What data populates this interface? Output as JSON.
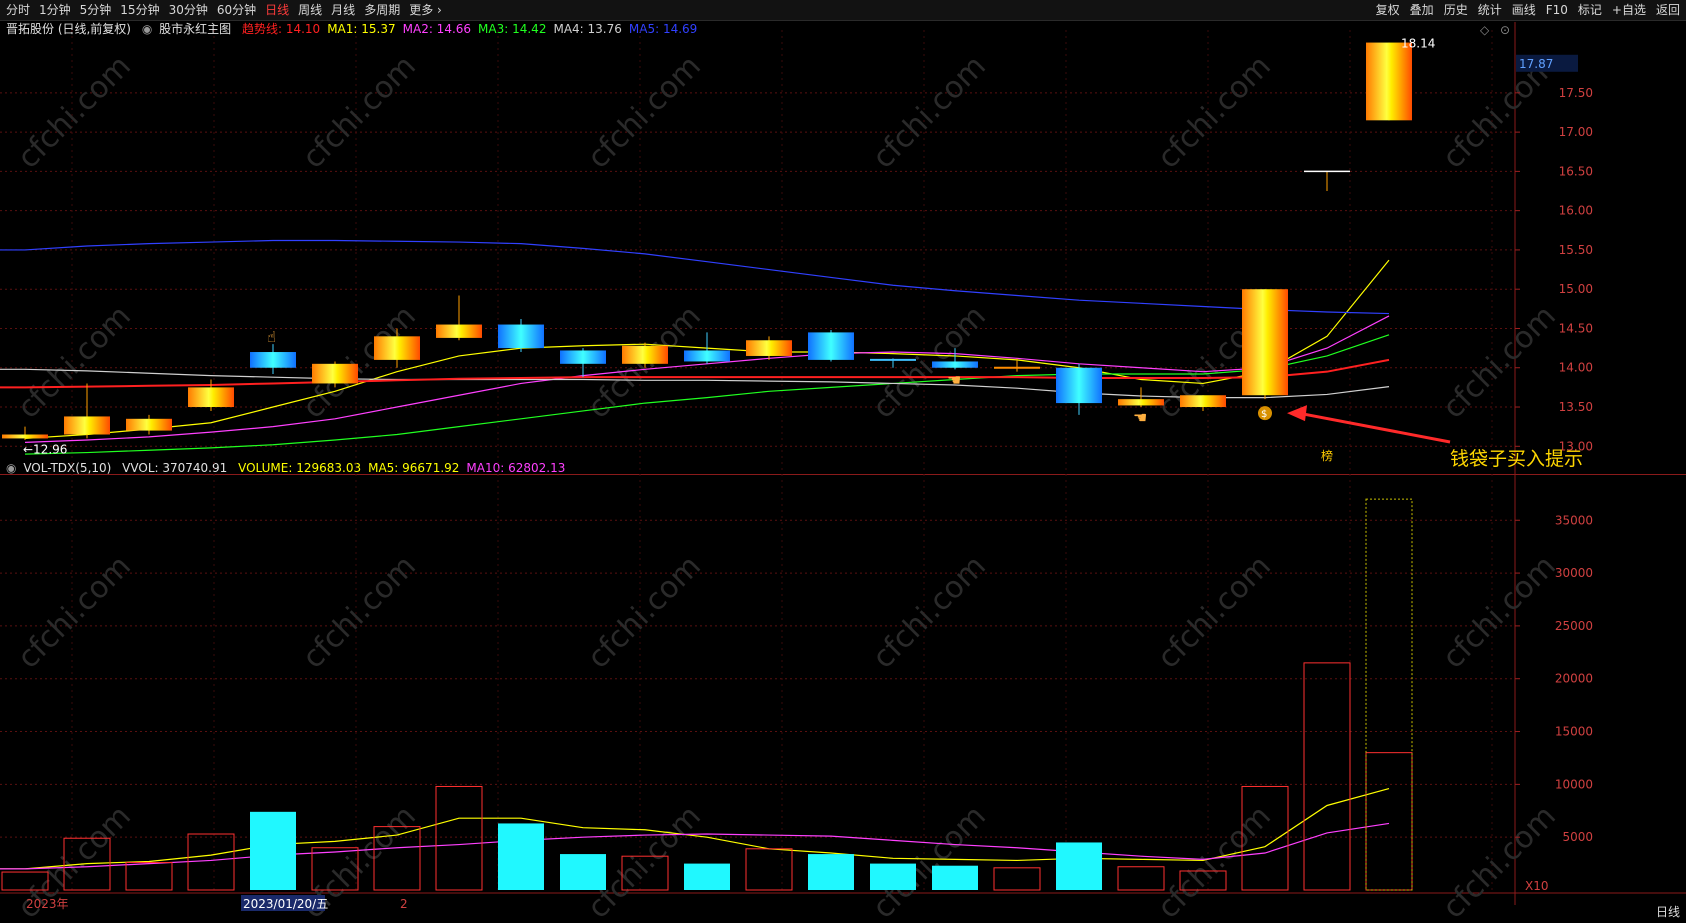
{
  "toolbar": {
    "left_tabs": [
      "分时",
      "1分钟",
      "5分钟",
      "15分钟",
      "30分钟",
      "60分钟",
      "日线",
      "周线",
      "月线",
      "多周期",
      "更多 ›"
    ],
    "active_tab": "日线",
    "right_tabs": [
      "复权",
      "叠加",
      "历史",
      "统计",
      "画线",
      "F10",
      "标记",
      "+自选",
      "返回"
    ]
  },
  "main_legend": {
    "stock": "晋拓股份 (日线,前复权)",
    "indicator": "股市永红主图",
    "items": [
      {
        "label": "趋势线: 14.10",
        "color": "#ff2020"
      },
      {
        "label": "MA1: 15.37",
        "color": "#ffff00"
      },
      {
        "label": "MA2: 14.66",
        "color": "#ff40ff"
      },
      {
        "label": "MA3: 14.42",
        "color": "#20ff20"
      },
      {
        "label": "MA4: 13.76",
        "color": "#d0d0d0"
      },
      {
        "label": "MA5: 14.69",
        "color": "#3040ff"
      }
    ]
  },
  "vol_legend": {
    "name": "VOL-TDX(5,10)",
    "vvol": "VVOL: 370740.91",
    "items": [
      {
        "label": "VOLUME: 129683.03",
        "color": "#ffff00"
      },
      {
        "label": "MA5: 96671.92",
        "color": "#ffff00"
      },
      {
        "label": "MA10: 62802.13",
        "color": "#ff40ff"
      }
    ]
  },
  "price_axis": {
    "ticks": [
      "17.50",
      "17.00",
      "16.50",
      "16.00",
      "15.50",
      "15.00",
      "14.50",
      "14.00",
      "13.50",
      "13.00"
    ],
    "current_price": "17.87"
  },
  "vol_axis": {
    "ticks": [
      "35000",
      "30000",
      "25000",
      "20000",
      "15000",
      "10000",
      "5000"
    ],
    "unit": "X10"
  },
  "annotations": {
    "high": "18.14",
    "low": "←12.96",
    "callout": "钱袋子买入提示",
    "badge": "榜"
  },
  "date_axis": {
    "labels": [
      "2023年",
      "2023/01/20/五",
      "2"
    ]
  },
  "period_label": "日线",
  "chart_data": {
    "type": "candlestick",
    "price_ylim": [
      12.8,
      18.3
    ],
    "volume_ylim": [
      0,
      39000
    ],
    "candles": [
      {
        "o": 13.1,
        "c": 13.15,
        "h": 13.25,
        "l": 13.08,
        "v": 1700,
        "up": true
      },
      {
        "o": 13.15,
        "c": 13.38,
        "h": 13.8,
        "l": 13.1,
        "v": 4900,
        "up": true
      },
      {
        "o": 13.2,
        "c": 13.35,
        "h": 13.4,
        "l": 13.15,
        "v": 2600,
        "up": true
      },
      {
        "o": 13.5,
        "c": 13.75,
        "h": 13.85,
        "l": 13.45,
        "v": 5300,
        "up": true
      },
      {
        "o": 14.2,
        "c": 14.0,
        "h": 14.3,
        "l": 13.92,
        "v": 7400,
        "up": false
      },
      {
        "o": 13.8,
        "c": 14.05,
        "h": 14.08,
        "l": 13.75,
        "v": 4000,
        "up": true
      },
      {
        "o": 14.1,
        "c": 14.4,
        "h": 14.5,
        "l": 14.0,
        "v": 6000,
        "up": true
      },
      {
        "o": 14.38,
        "c": 14.55,
        "h": 14.92,
        "l": 14.35,
        "v": 9800,
        "up": true
      },
      {
        "o": 14.55,
        "c": 14.25,
        "h": 14.62,
        "l": 14.2,
        "v": 6300,
        "up": false
      },
      {
        "o": 14.22,
        "c": 14.05,
        "h": 14.25,
        "l": 13.88,
        "v": 3400,
        "up": false
      },
      {
        "o": 14.05,
        "c": 14.28,
        "h": 14.32,
        "l": 14.0,
        "v": 3200,
        "up": true
      },
      {
        "o": 14.22,
        "c": 14.08,
        "h": 14.45,
        "l": 14.05,
        "v": 2500,
        "up": false
      },
      {
        "o": 14.15,
        "c": 14.35,
        "h": 14.4,
        "l": 14.1,
        "v": 3900,
        "up": true
      },
      {
        "o": 14.45,
        "c": 14.1,
        "h": 14.48,
        "l": 14.08,
        "v": 3400,
        "up": false
      },
      {
        "o": 14.1,
        "c": 14.08,
        "h": 14.12,
        "l": 14.0,
        "v": 2500,
        "up": false
      },
      {
        "o": 14.08,
        "c": 14.0,
        "h": 14.25,
        "l": 13.98,
        "v": 2300,
        "up": false
      },
      {
        "o": 14.0,
        "c": 14.02,
        "h": 14.12,
        "l": 13.95,
        "v": 2100,
        "up": true
      },
      {
        "o": 14.0,
        "c": 13.55,
        "h": 14.05,
        "l": 13.4,
        "v": 4500,
        "up": false
      },
      {
        "o": 13.52,
        "c": 13.6,
        "h": 13.75,
        "l": 13.5,
        "v": 2200,
        "up": true
      },
      {
        "o": 13.5,
        "c": 13.65,
        "h": 13.65,
        "l": 13.45,
        "v": 1800,
        "up": true
      },
      {
        "o": 13.65,
        "c": 15.0,
        "h": 15.0,
        "l": 13.6,
        "v": 9800,
        "up": true
      },
      {
        "o": 16.5,
        "c": 16.5,
        "h": 16.5,
        "l": 16.25,
        "v": 21500,
        "up": true
      },
      {
        "o": 17.15,
        "c": 18.14,
        "h": 18.14,
        "l": 17.15,
        "v": 13000,
        "vvol": 37000,
        "up": true
      }
    ],
    "series": [
      {
        "name": "MA1",
        "color": "#ffff00",
        "values": [
          13.1,
          13.15,
          13.22,
          13.3,
          13.5,
          13.7,
          13.95,
          14.15,
          14.25,
          14.28,
          14.3,
          14.25,
          14.2,
          14.2,
          14.18,
          14.15,
          14.1,
          14.0,
          13.85,
          13.8,
          13.95,
          14.4,
          15.37
        ]
      },
      {
        "name": "MA2",
        "color": "#ff40ff",
        "values": [
          13.05,
          13.08,
          13.12,
          13.18,
          13.25,
          13.35,
          13.5,
          13.65,
          13.8,
          13.9,
          13.98,
          14.05,
          14.12,
          14.18,
          14.2,
          14.18,
          14.12,
          14.05,
          14.0,
          13.95,
          14.0,
          14.25,
          14.66
        ]
      },
      {
        "name": "MA3",
        "color": "#20ff20",
        "values": [
          12.9,
          12.92,
          12.95,
          12.98,
          13.02,
          13.08,
          13.15,
          13.25,
          13.35,
          13.45,
          13.55,
          13.62,
          13.7,
          13.75,
          13.8,
          13.85,
          13.9,
          13.92,
          13.92,
          13.92,
          13.98,
          14.15,
          14.42
        ]
      },
      {
        "name": "MA4",
        "color": "#d0d0d0",
        "values": [
          13.98,
          13.96,
          13.93,
          13.9,
          13.88,
          13.86,
          13.85,
          13.85,
          13.85,
          13.85,
          13.84,
          13.84,
          13.83,
          13.82,
          13.8,
          13.78,
          13.74,
          13.68,
          13.64,
          13.62,
          13.62,
          13.66,
          13.76
        ]
      },
      {
        "name": "MA5",
        "color": "#3040ff",
        "values": [
          15.5,
          15.55,
          15.58,
          15.6,
          15.62,
          15.62,
          15.61,
          15.6,
          15.58,
          15.52,
          15.45,
          15.35,
          15.25,
          15.15,
          15.05,
          14.98,
          14.92,
          14.86,
          14.82,
          14.78,
          14.74,
          14.71,
          14.69
        ]
      },
      {
        "name": "趋势线",
        "color": "#ff2020",
        "values": [
          13.75,
          13.76,
          13.77,
          13.78,
          13.8,
          13.82,
          13.84,
          13.86,
          13.87,
          13.88,
          13.88,
          13.88,
          13.88,
          13.88,
          13.88,
          13.88,
          13.88,
          13.87,
          13.87,
          13.87,
          13.88,
          13.95,
          14.1
        ]
      }
    ],
    "vol_series": [
      {
        "name": "MA5",
        "color": "#ffff00",
        "values": [
          2000,
          2500,
          2700,
          3300,
          4300,
          4600,
          5200,
          6800,
          6800,
          5900,
          5700,
          5000,
          3900,
          3500,
          3000,
          2900,
          2800,
          3000,
          2900,
          2800,
          4100,
          8000,
          9600
        ]
      },
      {
        "name": "MA10",
        "color": "#ff40ff",
        "values": [
          2000,
          2200,
          2500,
          2800,
          3300,
          3600,
          4000,
          4300,
          4700,
          5000,
          5200,
          5300,
          5200,
          5100,
          4700,
          4300,
          4000,
          3600,
          3200,
          2900,
          3500,
          5400,
          6300
        ]
      }
    ],
    "icons": [
      {
        "type": "hand-up",
        "index": 4
      },
      {
        "type": "hand-point",
        "index": 15
      },
      {
        "type": "hand-point",
        "index": 18
      },
      {
        "type": "money-bag",
        "index": 20
      }
    ]
  }
}
